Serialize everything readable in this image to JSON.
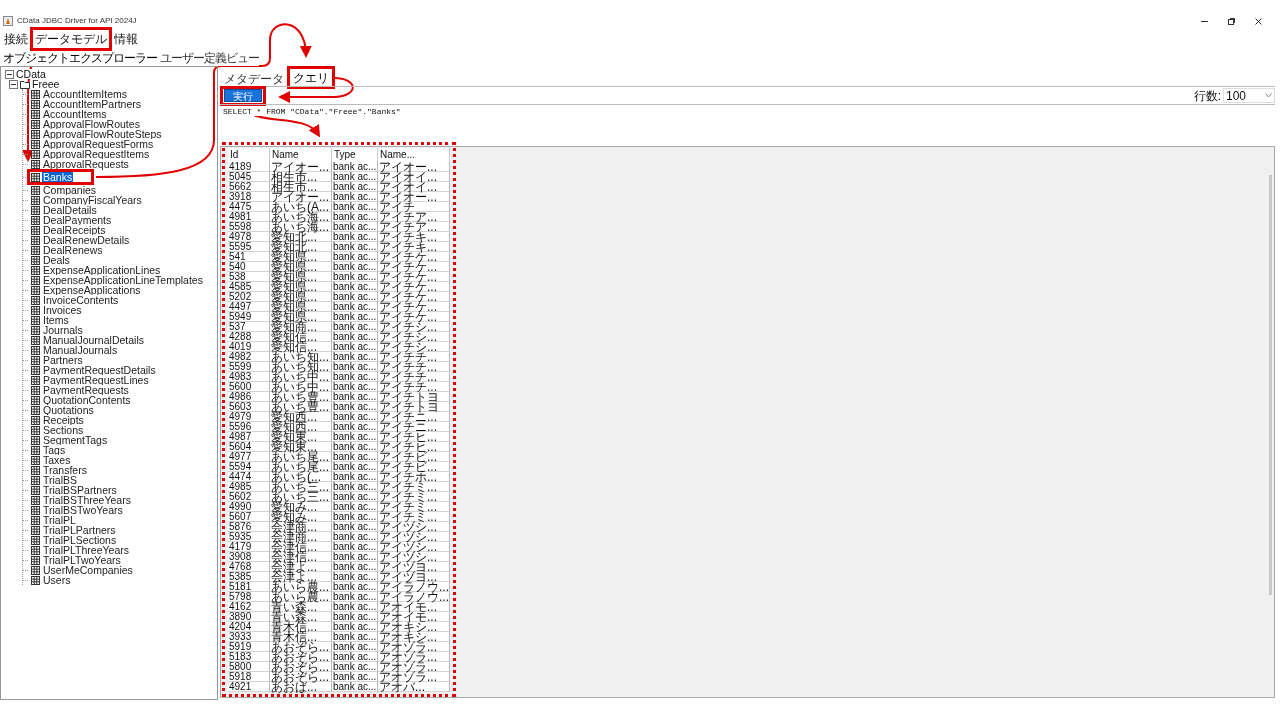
{
  "window": {
    "title": "CData JDBC Driver for API 2024J"
  },
  "menu": [
    {
      "label": "接続"
    },
    {
      "label": "データモデル"
    },
    {
      "label": "情報"
    }
  ],
  "explorer_tabs": [
    {
      "label": "オブジェクトエクスプローラー",
      "selected": true
    },
    {
      "label": "ユーザー定義ビュー",
      "selected": false
    }
  ],
  "tree": [
    {
      "label": "CData",
      "expanded": true,
      "children": [
        {
          "label": "Freee",
          "expanded": true,
          "children": [
            {
              "label": "AccountItemItems",
              "selected": false
            },
            {
              "label": "AccountItemPartners",
              "selected": false
            },
            {
              "label": "AccountItems",
              "selected": false
            },
            {
              "label": "ApprovalFlowRoutes",
              "selected": false
            },
            {
              "label": "ApprovalFlowRouteSteps",
              "selected": false
            },
            {
              "label": "ApprovalRequestForms",
              "selected": false
            },
            {
              "label": "ApprovalRequestItems",
              "selected": false
            },
            {
              "label": "ApprovalRequests",
              "selected": false
            },
            {
              "label": "Banks",
              "selected": true
            },
            {
              "label": "Companies",
              "selected": false
            },
            {
              "label": "CompanyFiscalYears",
              "selected": false
            },
            {
              "label": "DealDetails",
              "selected": false
            },
            {
              "label": "DealPayments",
              "selected": false
            },
            {
              "label": "DealReceipts",
              "selected": false
            },
            {
              "label": "DealRenewDetails",
              "selected": false
            },
            {
              "label": "DealRenews",
              "selected": false
            },
            {
              "label": "Deals",
              "selected": false
            },
            {
              "label": "ExpenseApplicationLines",
              "selected": false
            },
            {
              "label": "ExpenseApplicationLineTemplates",
              "selected": false
            },
            {
              "label": "ExpenseApplications",
              "selected": false
            },
            {
              "label": "InvoiceContents",
              "selected": false
            },
            {
              "label": "Invoices",
              "selected": false
            },
            {
              "label": "Items",
              "selected": false
            },
            {
              "label": "Journals",
              "selected": false
            },
            {
              "label": "ManualJournalDetails",
              "selected": false
            },
            {
              "label": "ManualJournals",
              "selected": false
            },
            {
              "label": "Partners",
              "selected": false
            },
            {
              "label": "PaymentRequestDetails",
              "selected": false
            },
            {
              "label": "PaymentRequestLines",
              "selected": false
            },
            {
              "label": "PaymentRequests",
              "selected": false
            },
            {
              "label": "QuotationContents",
              "selected": false
            },
            {
              "label": "Quotations",
              "selected": false
            },
            {
              "label": "Receipts",
              "selected": false
            },
            {
              "label": "Sections",
              "selected": false
            },
            {
              "label": "SegmentTags",
              "selected": false
            },
            {
              "label": "Tags",
              "selected": false
            },
            {
              "label": "Taxes",
              "selected": false
            },
            {
              "label": "Transfers",
              "selected": false
            },
            {
              "label": "TrialBS",
              "selected": false
            },
            {
              "label": "TrialBSPartners",
              "selected": false
            },
            {
              "label": "TrialBSThreeYears",
              "selected": false
            },
            {
              "label": "TrialBSTwoYears",
              "selected": false
            },
            {
              "label": "TrialPL",
              "selected": false
            },
            {
              "label": "TrialPLPartners",
              "selected": false
            },
            {
              "label": "TrialPLSections",
              "selected": false
            },
            {
              "label": "TrialPLThreeYears",
              "selected": false
            },
            {
              "label": "TrialPLTwoYears",
              "selected": false
            },
            {
              "label": "UserMeCompanies",
              "selected": false
            },
            {
              "label": "Users",
              "selected": false
            }
          ]
        }
      ]
    }
  ],
  "query_tabs": [
    {
      "label": "メタデータ",
      "selected": false
    },
    {
      "label": "クエリ",
      "selected": true
    }
  ],
  "run_button": "実行",
  "row_limit": {
    "label": "行数:",
    "value": "100"
  },
  "sql": "SELECT * FROM \"CData\".\"Freee\".\"Banks\"",
  "results": {
    "columns": [
      "Id",
      "Name",
      "Type",
      "Name..."
    ],
    "rows": [
      [
        "4189",
        "アイオー...",
        "bank ac...",
        "アイオー..."
      ],
      [
        "5045",
        "相生市...",
        "bank ac...",
        "アイオイ..."
      ],
      [
        "5662",
        "相生市...",
        "bank ac...",
        "アイオイ..."
      ],
      [
        "3918",
        "アイオー...",
        "bank ac...",
        "アイオー..."
      ],
      [
        "4475",
        "あいち(A...",
        "bank ac...",
        "アイチ"
      ],
      [
        "4981",
        "あいち海...",
        "bank ac...",
        "アイチア..."
      ],
      [
        "5598",
        "あいち海...",
        "bank ac...",
        "アイチア..."
      ],
      [
        "4978",
        "愛知北...",
        "bank ac...",
        "アイチキ..."
      ],
      [
        "5595",
        "愛知北...",
        "bank ac...",
        "アイチキ..."
      ],
      [
        "541",
        "愛知県...",
        "bank ac...",
        "アイチケ..."
      ],
      [
        "540",
        "愛知県...",
        "bank ac...",
        "アイチケ..."
      ],
      [
        "538",
        "愛知県...",
        "bank ac...",
        "アイチケ..."
      ],
      [
        "4585",
        "愛知県...",
        "bank ac...",
        "アイチケ..."
      ],
      [
        "5202",
        "愛知県...",
        "bank ac...",
        "アイチケ..."
      ],
      [
        "4497",
        "愛知県...",
        "bank ac...",
        "アイチケ..."
      ],
      [
        "5949",
        "愛知県...",
        "bank ac...",
        "アイチケ..."
      ],
      [
        "537",
        "愛知商...",
        "bank ac...",
        "アイチシ..."
      ],
      [
        "4288",
        "愛知信...",
        "bank ac...",
        "アイチシ..."
      ],
      [
        "4019",
        "愛知信...",
        "bank ac...",
        "アイチシ..."
      ],
      [
        "4982",
        "あいち知...",
        "bank ac...",
        "アイチチ..."
      ],
      [
        "5599",
        "あいち知...",
        "bank ac...",
        "アイチチ..."
      ],
      [
        "4983",
        "あいち中...",
        "bank ac...",
        "アイチチ..."
      ],
      [
        "5600",
        "あいち中...",
        "bank ac...",
        "アイチチ..."
      ],
      [
        "4986",
        "あいち豊...",
        "bank ac...",
        "アイチトヨ"
      ],
      [
        "5603",
        "あいち豊...",
        "bank ac...",
        "アイチトヨ"
      ],
      [
        "4979",
        "愛知西...",
        "bank ac...",
        "アイチニ..."
      ],
      [
        "5596",
        "愛知西...",
        "bank ac...",
        "アイチニ..."
      ],
      [
        "4987",
        "愛知東...",
        "bank ac...",
        "アイチヒ..."
      ],
      [
        "5604",
        "愛知東...",
        "bank ac...",
        "アイチヒ..."
      ],
      [
        "4977",
        "あいち尾...",
        "bank ac...",
        "アイチビ..."
      ],
      [
        "5594",
        "あいち尾...",
        "bank ac...",
        "アイチビ..."
      ],
      [
        "4474",
        "あいち(...",
        "bank ac...",
        "アイチホ..."
      ],
      [
        "4985",
        "あいち三...",
        "bank ac...",
        "アイチミ..."
      ],
      [
        "5602",
        "あいち三...",
        "bank ac...",
        "アイチミ..."
      ],
      [
        "4990",
        "愛知み...",
        "bank ac...",
        "アイチミ..."
      ],
      [
        "5607",
        "愛知み...",
        "bank ac...",
        "アイチミ..."
      ],
      [
        "5876",
        "会津商...",
        "bank ac...",
        "アイヅシ..."
      ],
      [
        "5935",
        "会津商...",
        "bank ac...",
        "アイヅシ..."
      ],
      [
        "4179",
        "会津信...",
        "bank ac...",
        "アイヅシ..."
      ],
      [
        "3908",
        "会津信...",
        "bank ac...",
        "アイヅシ..."
      ],
      [
        "4768",
        "会津よ...",
        "bank ac...",
        "アイヅヨ..."
      ],
      [
        "5385",
        "会津よ...",
        "bank ac...",
        "アイヅヨ..."
      ],
      [
        "5181",
        "あいら農...",
        "bank ac...",
        "アイラノウ..."
      ],
      [
        "5798",
        "あいら農...",
        "bank ac...",
        "アイラノウ..."
      ],
      [
        "4162",
        "青い森...",
        "bank ac...",
        "アオイモ..."
      ],
      [
        "3890",
        "青い森...",
        "bank ac...",
        "アオイモ..."
      ],
      [
        "4204",
        "青木信...",
        "bank ac...",
        "アオキシ..."
      ],
      [
        "3933",
        "青木信...",
        "bank ac...",
        "アオキシ..."
      ],
      [
        "5919",
        "あおぞら...",
        "bank ac...",
        "アオゾラ..."
      ],
      [
        "5183",
        "あおぞら...",
        "bank ac...",
        "アオゾラ..."
      ],
      [
        "5800",
        "あおぞら...",
        "bank ac...",
        "アオゾラ..."
      ],
      [
        "5918",
        "あおぞら...",
        "bank ac...",
        "アオゾラ..."
      ],
      [
        "4921",
        "あおば...",
        "bank ac...",
        "アオバ..."
      ]
    ]
  }
}
